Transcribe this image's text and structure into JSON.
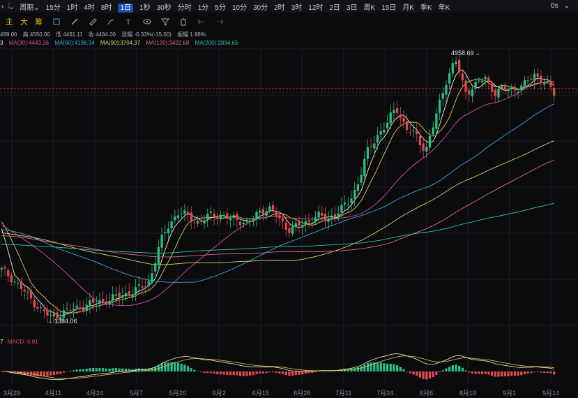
{
  "toolbar": {
    "period_label": "周期",
    "intervals": [
      "15分",
      "1时",
      "4时",
      "8时",
      "1日",
      "1秒",
      "30秒",
      "分时",
      "1分",
      "5分",
      "10分",
      "30分",
      "2时",
      "3时",
      "12时",
      "2日",
      "3日",
      "周K",
      "15日",
      "月K",
      "季K",
      "年K"
    ],
    "active_interval": "1日",
    "right_label": "0s"
  },
  "tabs": {
    "main": "主",
    "big": "大",
    "chips": "筹"
  },
  "ohlc": {
    "open": "499.00",
    "high": "高 4550.00",
    "low": "低 4461.11",
    "close": "收 4484.00",
    "change": "涨幅 -0.33%(-15.00)",
    "amplitude": "振幅 1.98%"
  },
  "ma_legend": {
    "lead": "3",
    "ma30": "MA(30):4443.36",
    "ma60": "MA(60):4198.34",
    "ma90": "MA(90):3704.37",
    "ma120": "MA(120):3422.68",
    "ma200": "MA(200):2834.65"
  },
  "macd_legend": {
    "lead": "7",
    "macd": "MACD:-0.81"
  },
  "annotations": {
    "high": "4958.69",
    "low": "1384.06"
  },
  "colors": {
    "up": "#2ebd85",
    "down": "#e0494f",
    "ma5": "#f5f0d0",
    "ma10": "#e8c84b",
    "ma30": "#d64fa8",
    "ma60": "#3ba7d9",
    "ma90": "#d9d46a",
    "ma120": "#d66a8a",
    "ma200": "#2fbfb0"
  },
  "chart_data": {
    "type": "candlestick",
    "x_ticks": [
      "3月29",
      "4月11",
      "4月24",
      "5月7",
      "5月20",
      "6月2",
      "6月15",
      "6月28",
      "7月11",
      "7月24",
      "8月6",
      "8月19",
      "9月1",
      "9月14"
    ],
    "price_marks": {
      "high": 4958.69,
      "low": 1384.06,
      "last": 4484.0
    },
    "close_path": [
      2050,
      1950,
      1800,
      1650,
      1500,
      1400,
      1460,
      1500,
      1550,
      1580,
      1620,
      1650,
      1700,
      1740,
      1800,
      1900,
      2400,
      2700,
      2850,
      2780,
      2700,
      2800,
      2820,
      2760,
      2750,
      2700,
      2840,
      2920,
      2780,
      2620,
      2650,
      2720,
      2800,
      2750,
      2850,
      2950,
      3200,
      3650,
      3900,
      4050,
      4300,
      4000,
      3900,
      3700,
      4150,
      4650,
      4950,
      4500,
      4600,
      4700,
      4500,
      4550,
      4550,
      4600,
      4750,
      4650,
      4484
    ],
    "series_end_values": {
      "MA(30)": 4443.36,
      "MA(60)": 4198.34,
      "MA(90)": 3704.37,
      "MA(120)": 3422.68,
      "MA(200)": 2834.65
    },
    "macd_last": -0.81
  }
}
